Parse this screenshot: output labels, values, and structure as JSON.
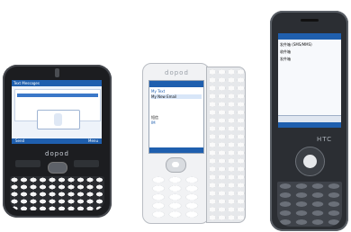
{
  "phone1": {
    "brand": "dopod",
    "screen_title": "Text Messages",
    "softkeys": [
      "Send",
      "Menu"
    ]
  },
  "phone2": {
    "brand": "dopod",
    "screen_lines": [
      "My Text",
      "My New Email",
      "短信",
      "IM"
    ]
  },
  "phone3": {
    "brand": "HTC",
    "screen_lines": [
      "发件箱 (SMS/MMS)",
      "收件箱",
      "发件箱"
    ]
  },
  "colors": {
    "screen_blue": "#1f5fae",
    "body_dark": "#2b2e33",
    "body_silver": "#d7dbe0"
  }
}
